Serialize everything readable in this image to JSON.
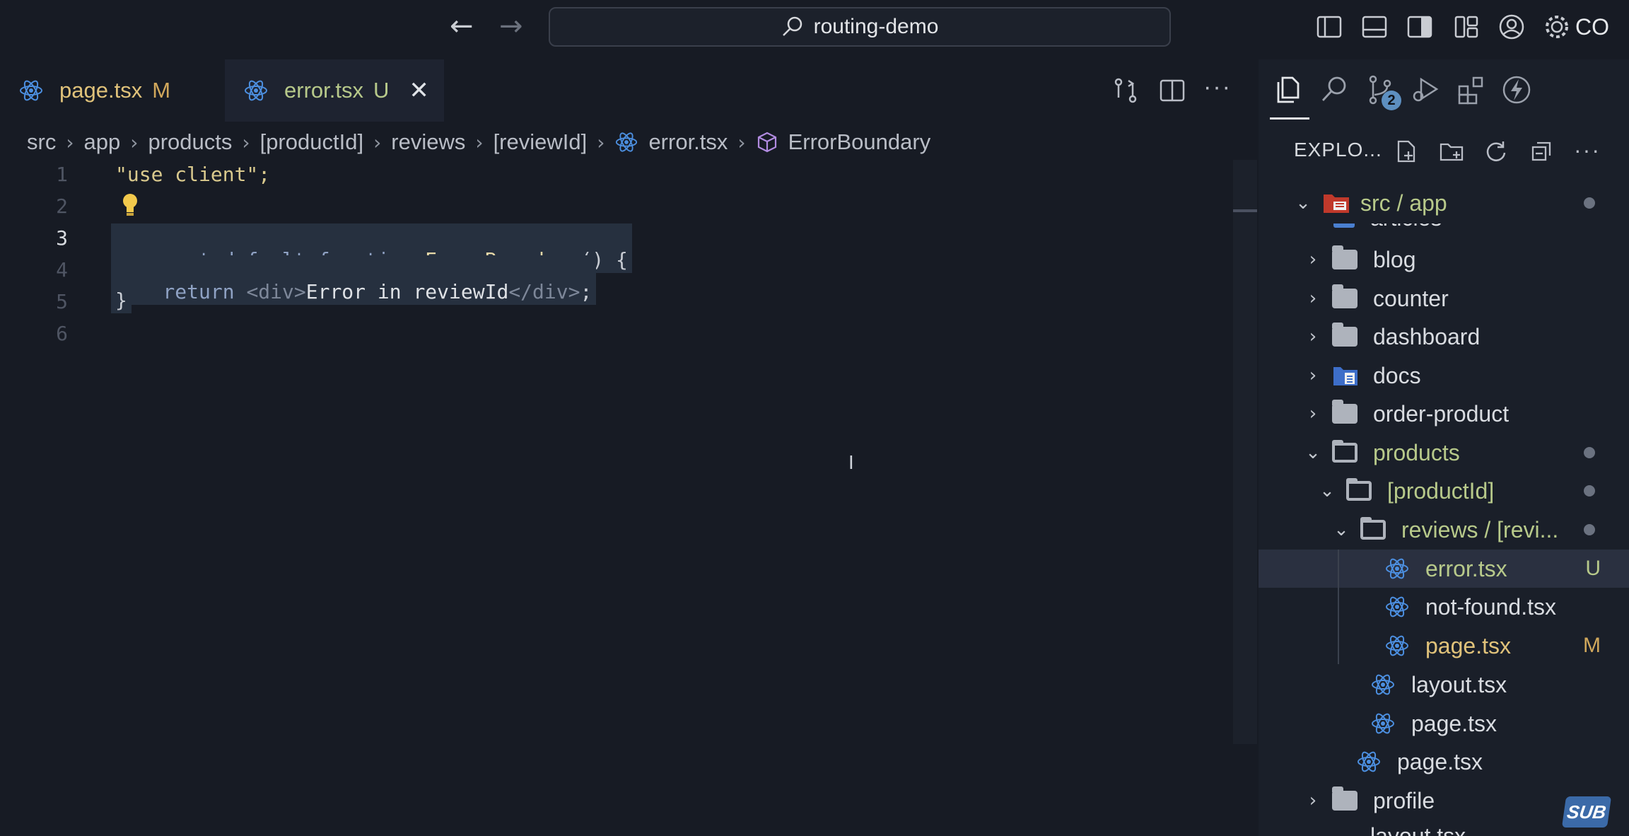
{
  "titlebar": {
    "search_text": "routing-demo",
    "account_label": "CO"
  },
  "tabs": [
    {
      "label": "page.tsx",
      "status": "M"
    },
    {
      "label": "error.tsx",
      "status": "U"
    }
  ],
  "breadcrumb": [
    "src",
    "app",
    "products",
    "[productId]",
    "reviews",
    "[reviewId]",
    "error.tsx",
    "ErrorBoundary"
  ],
  "editor": {
    "line_numbers": [
      "1",
      "2",
      "3",
      "4",
      "5",
      "6"
    ],
    "lines": {
      "l1": "\"use client\";",
      "l3_kw": "export default function ",
      "l3_fn": "ErrorBoundary",
      "l3_rest": "() {",
      "l4_kw": "  return ",
      "l4_tag1": "<div>",
      "l4_text": "Error in reviewId",
      "l4_tag2": "</div>",
      "l4_end": ";",
      "l5": "}"
    }
  },
  "activity_bar": {
    "scm_badge": "2"
  },
  "explorer": {
    "title": "EXPLO...",
    "root": "src / app",
    "items": [
      {
        "label": "articles"
      },
      {
        "label": "blog"
      },
      {
        "label": "counter"
      },
      {
        "label": "dashboard"
      },
      {
        "label": "docs"
      },
      {
        "label": "order-product"
      },
      {
        "label": "products"
      },
      {
        "label": "[productId]"
      },
      {
        "label": "reviews / [revi..."
      },
      {
        "label": "error.tsx",
        "status": "U"
      },
      {
        "label": "not-found.tsx"
      },
      {
        "label": "page.tsx",
        "status": "M"
      },
      {
        "label": "layout.tsx"
      },
      {
        "label": "page.tsx"
      },
      {
        "label": "page.tsx"
      },
      {
        "label": "profile"
      },
      {
        "label": "layout.tsx"
      }
    ]
  },
  "watermark": "SUB",
  "colors": {
    "modified": "#e0c27a",
    "untracked": "#b7c98a",
    "react": "#4c8fe0",
    "selection": "#26303f"
  }
}
